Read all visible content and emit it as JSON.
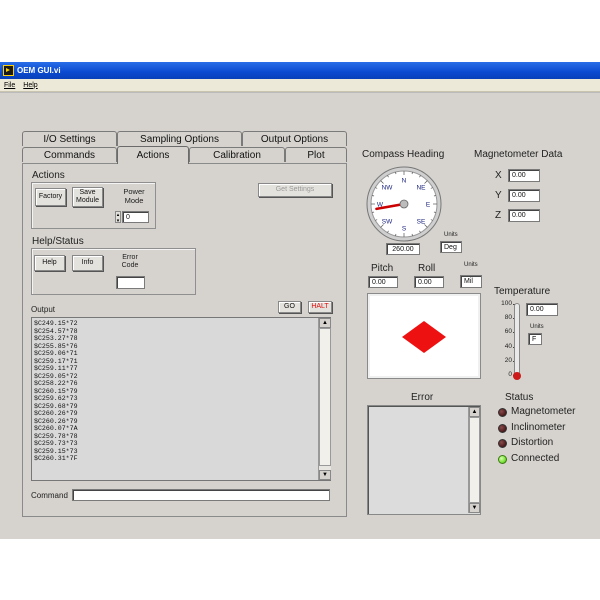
{
  "window": {
    "title": "OEM GUI.vi"
  },
  "menu": [
    "File",
    "Help"
  ],
  "tabs_back": [
    "I/O Settings",
    "Sampling Options",
    "Output Options"
  ],
  "tabs_front": [
    "Commands",
    "Actions",
    "Calibration",
    "Plot"
  ],
  "active_tab": "Actions",
  "actions": {
    "title": "Actions",
    "factory_label": "Factory",
    "save_module_label": "Save Module",
    "power_mode_label": "Power Mode",
    "power_mode_value": "0",
    "get_settings_label": "Get Settings"
  },
  "help_status": {
    "title": "Help/Status",
    "help_label": "Help",
    "info_label": "Info",
    "error_code_label": "Error Code",
    "error_code_value": ""
  },
  "output": {
    "label": "Output",
    "go_label": "GO",
    "halt_label": "HALT",
    "lines": [
      "$C249.15*72",
      "$C254.57*78",
      "$C253.27*78",
      "$C255.85*76",
      "$C259.06*71",
      "$C259.17*71",
      "$C259.11*77",
      "$C259.05*72",
      "$C258.22*76",
      "$C260.15*79",
      "$C259.62*73",
      "$C259.68*79",
      "$C260.26*79",
      "$C260.26*79",
      "$C260.07*7A",
      "$C259.78*78",
      "$C259.73*73",
      "$C259.15*73",
      "$C260.31*7F"
    ]
  },
  "command": {
    "label": "Command",
    "value": ""
  },
  "compass": {
    "title": "Compass Heading",
    "directions": [
      "N",
      "NE",
      "E",
      "SE",
      "S",
      "SW",
      "W",
      "NW"
    ],
    "heading_value": "260.00",
    "heading_degrees": 260,
    "units_label": "Units",
    "units_value": "Deg"
  },
  "attitude": {
    "pitch_label": "Pitch",
    "roll_label": "Roll",
    "pitch_value": "0.00",
    "roll_value": "0.00",
    "units_label": "Units",
    "units_value": "Mil"
  },
  "magnetometer": {
    "title": "Magnetometer Data",
    "axes": [
      {
        "label": "X",
        "value": "0.00"
      },
      {
        "label": "Y",
        "value": "0.00"
      },
      {
        "label": "Z",
        "value": "0.00"
      }
    ]
  },
  "temperature": {
    "title": "Temperature",
    "scale": [
      "100",
      "80",
      "60",
      "40",
      "20",
      "0"
    ],
    "value": "0.00",
    "units_label": "Units",
    "units_value": "F"
  },
  "error": {
    "title": "Error"
  },
  "status": {
    "title": "Status",
    "items": [
      {
        "label": "Magnetometer",
        "on": false
      },
      {
        "label": "Inclinometer",
        "on": false
      },
      {
        "label": "Distortion",
        "on": false
      },
      {
        "label": "Connected",
        "on": true
      }
    ]
  },
  "colors": {
    "led_off": "#4a1a1a",
    "led_on": "#7be23a",
    "accent_red": "#e01010",
    "titlebar": "#0a4ad0"
  }
}
